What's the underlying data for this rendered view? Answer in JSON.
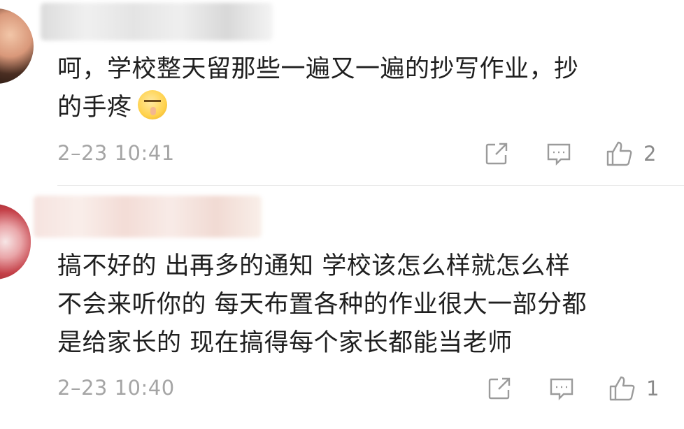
{
  "comments": [
    {
      "text_line1": "呵，学校整天留那些一遍又一遍的抄写作业，抄",
      "text_line2": "的手疼",
      "emoji": "shushing-face-emoji",
      "timestamp": "2–23 10:41",
      "actions": {
        "share_icon": "share-icon",
        "reply_icon": "comment-icon",
        "like_icon": "thumbs-up-icon",
        "like_count": "2"
      }
    },
    {
      "text_line1": "搞不好的 出再多的通知 学校该怎么样就怎么样",
      "text_line2": "不会来听你的 每天布置各种的作业很大一部分都",
      "text_line3": "是给家长的 现在搞得每个家长都能当老师",
      "timestamp": "2–23 10:40",
      "actions": {
        "share_icon": "share-icon",
        "reply_icon": "comment-icon",
        "like_icon": "thumbs-up-icon",
        "like_count": "1"
      }
    }
  ],
  "colors": {
    "text": "#1f1f1f",
    "meta": "#a5a5a5",
    "icon": "#9b9b9b",
    "divider": "#ebebeb"
  }
}
